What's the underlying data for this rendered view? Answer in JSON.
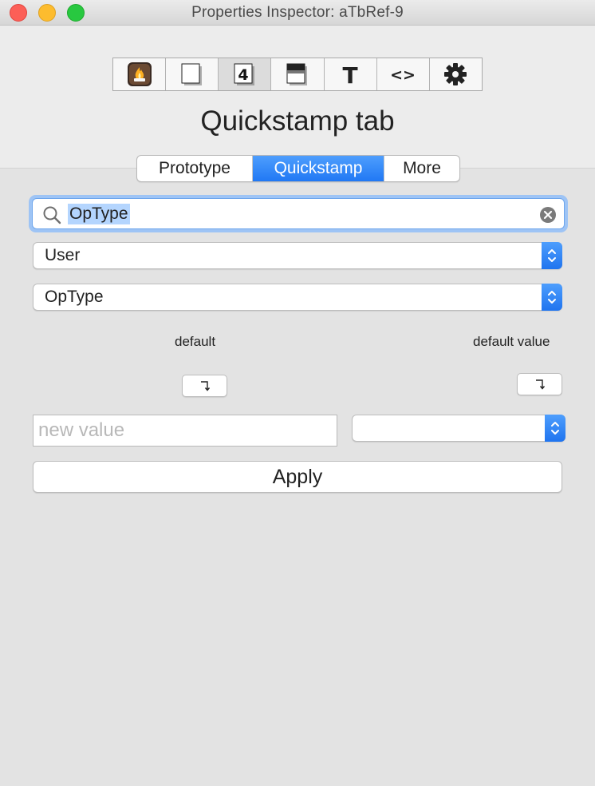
{
  "window": {
    "title": "Properties Inspector: aTbRef-9"
  },
  "toolbar": {
    "items": [
      {
        "icon": "flame-icon"
      },
      {
        "icon": "blank-page-icon"
      },
      {
        "icon": "number-four-icon",
        "label": "4"
      },
      {
        "icon": "shadow-page-icon"
      },
      {
        "icon": "text-icon",
        "label": "T"
      },
      {
        "icon": "code-brackets-icon",
        "label": "<>"
      },
      {
        "icon": "gear-icon"
      }
    ],
    "active_index": 2
  },
  "heading": "Quickstamp tab",
  "tabs": [
    {
      "label": "Prototype",
      "active": false
    },
    {
      "label": "Quickstamp",
      "active": true
    },
    {
      "label": "More",
      "active": false
    }
  ],
  "search": {
    "value": "OpType"
  },
  "attribute_set_popup": {
    "selected": "User"
  },
  "attribute_popup": {
    "selected": "OpType"
  },
  "labels": {
    "default": "default",
    "default_value": "default value"
  },
  "value_input": {
    "placeholder": "new value"
  },
  "apply_button": {
    "label": "Apply"
  },
  "colors": {
    "accent": "#2a7ff6",
    "selection": "#b4d5fe"
  }
}
